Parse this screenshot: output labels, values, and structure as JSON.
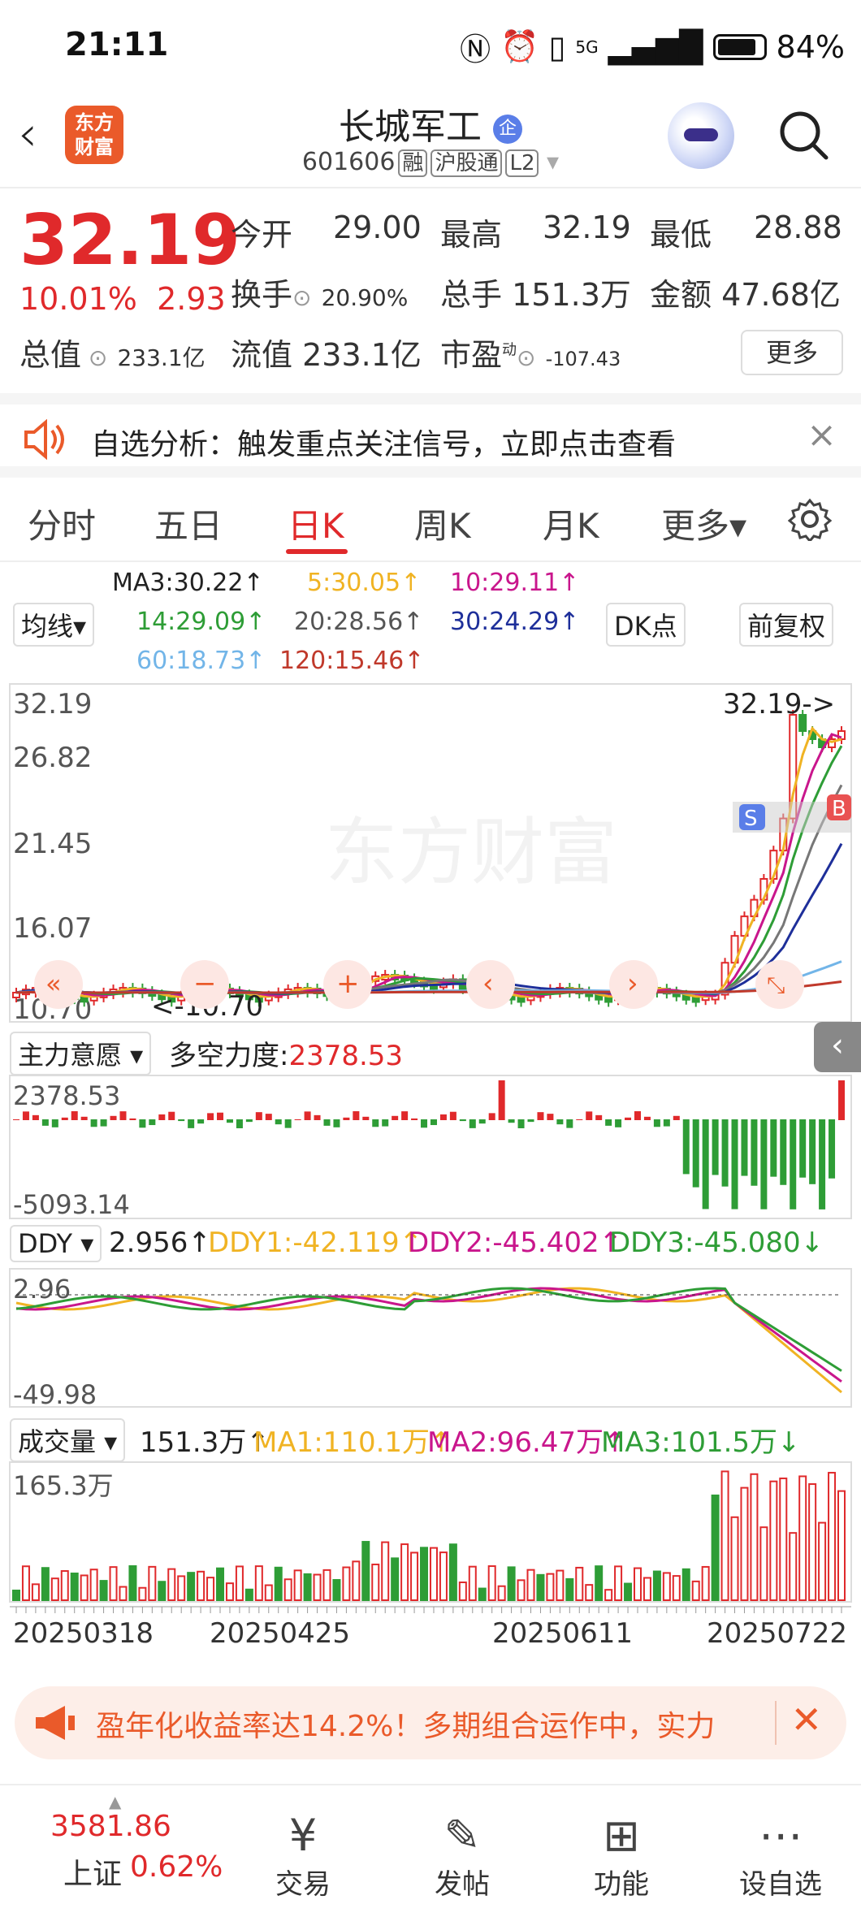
{
  "status": {
    "time": "21:11",
    "battery": "84%",
    "network": "5G"
  },
  "header": {
    "back": "‹",
    "logo_line1": "东方",
    "logo_line2": "财富",
    "name": "长城军工",
    "badge": "企",
    "code": "601606",
    "tag1": "融",
    "tag2": "沪股通",
    "tag3": "L2"
  },
  "quote": {
    "price": "32.19",
    "pct": "10.01%",
    "chg": "2.93",
    "open_label": "今开",
    "open": "29.00",
    "high_label": "最高",
    "high": "32.19",
    "low_label": "最低",
    "low": "28.88",
    "turnover_label": "换手",
    "turnover": "20.90%",
    "volume_label": "总手",
    "volume": "151.3万",
    "amount_label": "金额",
    "amount": "47.68亿",
    "mktcap_label": "总值",
    "mktcap": "233.1亿",
    "float_label": "流值",
    "float": "233.1亿",
    "pe_label": "市盈",
    "pe_sup": "动",
    "pe": "-107.43",
    "more": "更多"
  },
  "notice": {
    "text": "自选分析：触发重点关注信号，立即点击查看",
    "close": "×"
  },
  "tabs": {
    "t1": "分时",
    "t2": "五日",
    "t3": "日K",
    "t4": "周K",
    "t5": "月K",
    "t6": "更多▾"
  },
  "ma": {
    "selector": "均线▾",
    "dk": "DK点",
    "fq": "前复权",
    "ma3": "MA3:30.22↑",
    "ma5": "5:30.05↑",
    "ma10": "10:29.11↑",
    "ma14": "14:29.09↑",
    "ma20": "20:28.56↑",
    "ma30": "30:24.29↑",
    "ma60": "60:18.73↑",
    "ma120": "120:15.46↑"
  },
  "kline": {
    "y1": "32.19",
    "y2": "26.82",
    "y3": "21.45",
    "y4": "16.07",
    "y5": "10.70",
    "max_label": "32.19->",
    "min_label": "<-10.70",
    "watermark": "东方财富",
    "s": "S",
    "b": "B"
  },
  "zlyy": {
    "selector": "主力意愿 ▾",
    "label": "多空力度:",
    "value": "2378.53",
    "max": "2378.53",
    "min": "-5093.14"
  },
  "ddy": {
    "selector": "DDY ▾",
    "v": "2.956↑",
    "ddy1": "DDY1:-42.119↑",
    "ddy2": "DDY2:-45.402↑",
    "ddy3": "DDY3:-45.080↓",
    "max": "2.96",
    "min": "-49.98"
  },
  "vol": {
    "selector": "成交量 ▾",
    "v": "151.3万↑",
    "ma1": "MA1:110.1万↑",
    "ma2": "MA2:96.47万↑",
    "ma3": "MA3:101.5万↓",
    "max": "165.3万"
  },
  "dates": {
    "d1": "20250318",
    "d2": "20250425",
    "d3": "20250611",
    "d4": "20250722"
  },
  "banner": {
    "text": "盈年化收益率达14.2%！多期组合运作中，实力",
    "close": "✕"
  },
  "bottom": {
    "index_value": "3581.86",
    "index_name": "上证",
    "index_pct": "0.62%",
    "trade": "交易",
    "post": "发帖",
    "func": "功能",
    "watch": "设自选"
  },
  "colors": {
    "red": "#e0292b",
    "green": "#2e9d36",
    "orange": "#ea5a2a",
    "ma5": "#f0b323",
    "ma10": "#c9168c",
    "ma20": "#777777",
    "ma30": "#1e2f9a",
    "ma60": "#72b5e8",
    "ma120": "#c0392b"
  }
}
